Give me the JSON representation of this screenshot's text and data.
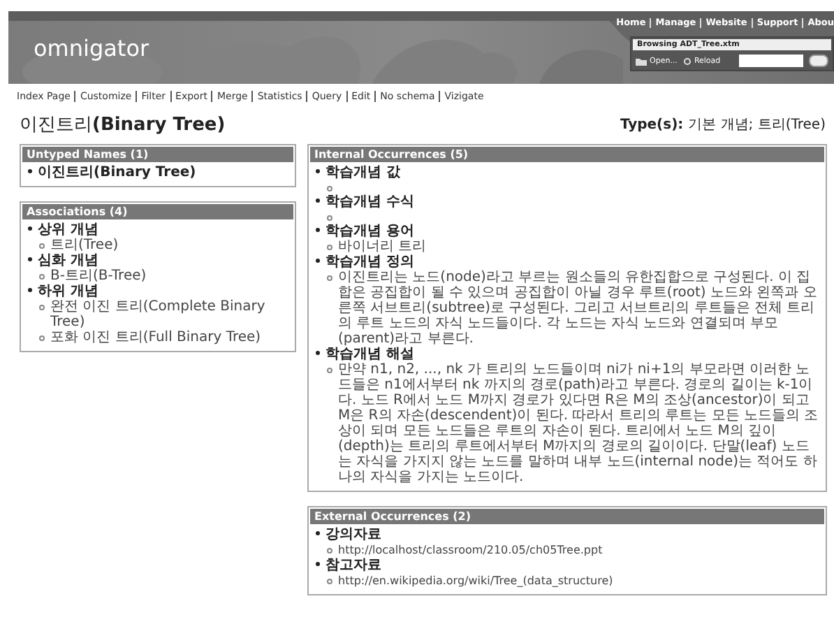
{
  "header": {
    "logo": "omnigator",
    "links": [
      "Home",
      "Manage",
      "Website",
      "Support",
      "Abou"
    ],
    "browsing": "Browsing ADT_Tree.xtm",
    "open": "Open...",
    "reload": "Reload"
  },
  "menu": [
    "Index Page",
    "Customize",
    "Filter",
    "Export",
    "Merge",
    "Statistics",
    "Query",
    "Edit",
    "No schema",
    "Vizigate"
  ],
  "topic": {
    "title_ko": "이진트리",
    "title_en": "(Binary Tree)",
    "types_label": "Type(s):",
    "types": "기본 개념; 트리(Tree)"
  },
  "untyped_names": {
    "title": "Untyped Names (1)",
    "items": [
      {
        "label": "이진트리(Binary Tree)"
      }
    ]
  },
  "associations": {
    "title": "Associations (4)",
    "items": [
      {
        "label": "상위 개념",
        "values": [
          "트리(Tree)"
        ]
      },
      {
        "label": "심화 개념",
        "values": [
          "B-트리(B-Tree)"
        ]
      },
      {
        "label": "하위 개념",
        "values": [
          "완전 이진 트리(Complete Binary Tree)",
          "포화 이진 트리(Full Binary Tree)"
        ]
      }
    ]
  },
  "internal_occurrences": {
    "title": "Internal Occurrences (5)",
    "items": [
      {
        "label": "학습개념 값"
      },
      {
        "label": "학습개념 수식"
      },
      {
        "label": "학습개념 용어",
        "values": [
          "바이너리 트리"
        ]
      },
      {
        "label": "학습개념 정의",
        "values": [
          "이진트리는 노드(node)라고 부르는 원소들의 유한집합으로 구성된다. 이 집합은 공집합이 될 수 있으며 공집합이 아닐 경우 루트(root) 노드와 왼쪽과 오른쪽 서브트리(subtree)로 구성된다. 그리고 서브트리의 루트들은 전체 트리의 루트 노드의 자식 노드들이다. 각 노드는 자식 노드와 연결되며 부모(parent)라고 부른다."
        ]
      },
      {
        "label": "학습개념 해설",
        "values": [
          "만약 n1, n2, ..., nk 가 트리의 노드들이며 ni가 ni+1의 부모라면 이러한 노드들은 n1에서부터 nk 까지의 경로(path)라고 부른다. 경로의 길이는 k-1이다. 노드 R에서 노드 M까지 경로가 있다면 R은 M의 조상(ancestor)이 되고 M은 R의 자손(descendent)이 된다. 따라서 트리의 루트는 모든 노드들의 조상이 되며 모든 노드들은 루트의 자손이 된다. 트리에서 노드 M의 깊이(depth)는 트리의 루트에서부터 M까지의 경로의 길이이다. 단말(leaf) 노드는 자식을 가지지 않는 노드를 말하며 내부 노드(internal node)는 적어도 하나의 자식을 가지는 노드이다."
        ]
      }
    ]
  },
  "external_occurrences": {
    "title": "External Occurrences (2)",
    "items": [
      {
        "label": "강의자료",
        "values": [
          "http://localhost/classroom/210.05/ch05Tree.ppt"
        ]
      },
      {
        "label": "참고자료",
        "values": [
          "http://en.wikipedia.org/wiki/Tree_(data_structure)"
        ]
      }
    ]
  }
}
